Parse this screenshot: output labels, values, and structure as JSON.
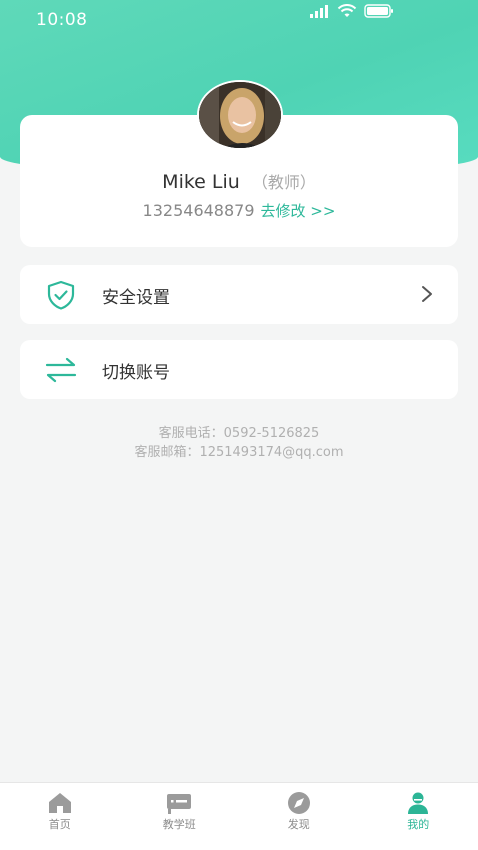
{
  "status_bar": {
    "time": "10:08"
  },
  "profile": {
    "name": "Mike Liu",
    "role": "（教师）",
    "phone": "13254648879",
    "edit_link": "去修改 >>"
  },
  "menu": [
    {
      "label": "安全设置",
      "icon": "shield-check-icon"
    },
    {
      "label": "切换账号",
      "icon": "swap-arrows-icon"
    }
  ],
  "service": {
    "phone": "客服电话：0592-5126825",
    "email": "客服邮箱：1251493174@qq.com"
  },
  "tabbar": [
    {
      "label": "首页",
      "icon": "home-icon",
      "active": false
    },
    {
      "label": "教学班",
      "icon": "class-icon",
      "active": false
    },
    {
      "label": "发现",
      "icon": "compass-icon",
      "active": false
    },
    {
      "label": "我的",
      "icon": "user-icon",
      "active": true
    }
  ],
  "colors": {
    "accent": "#2db89a",
    "header": "#52d6b7"
  }
}
